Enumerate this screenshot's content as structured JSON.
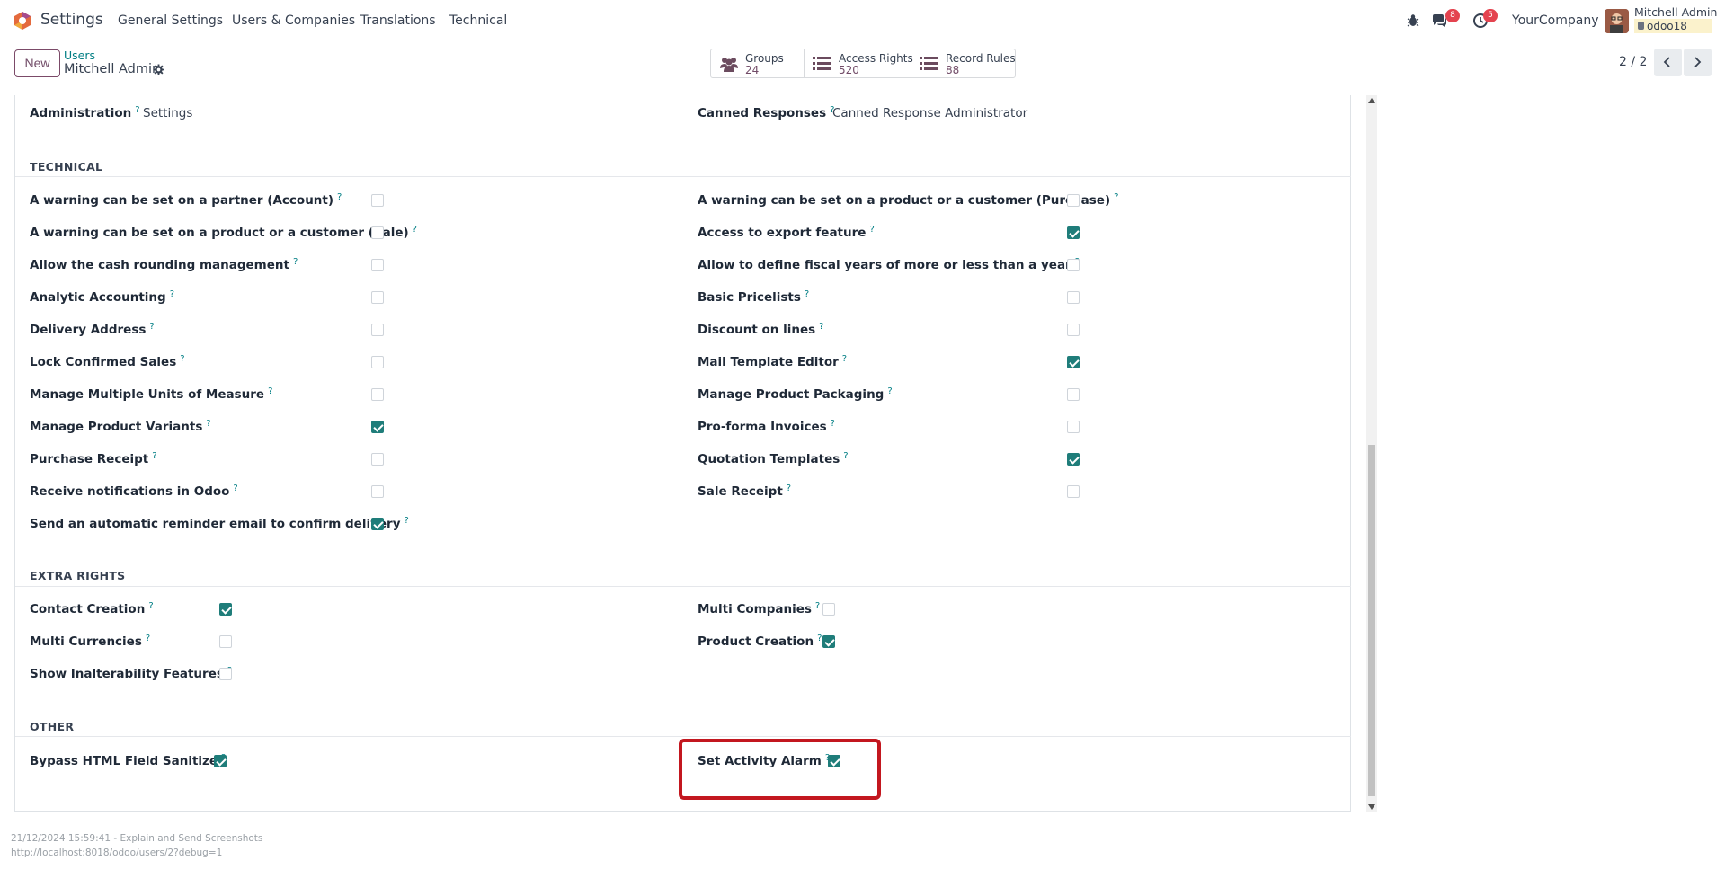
{
  "navbar": {
    "app_name": "Settings",
    "menu": [
      "General Settings",
      "Users & Companies",
      "Translations",
      "Technical"
    ],
    "messages_badge": "8",
    "activities_badge": "5",
    "company": "YourCompany",
    "user_name": "Mitchell Admin",
    "database": "odoo18"
  },
  "control": {
    "new_label": "New",
    "breadcrumb_parent": "Users",
    "breadcrumb_current": "Mitchell Admin",
    "smart_buttons": [
      {
        "label": "Groups",
        "value": "24",
        "icon": "users-icon"
      },
      {
        "label": "Access Rights",
        "value": "520",
        "icon": "list-icon"
      },
      {
        "label": "Record Rules",
        "value": "88",
        "icon": "list-icon"
      }
    ],
    "pager": "2 / 2"
  },
  "top_fields": {
    "administration_label": "Administration",
    "administration_value": "Settings",
    "canned_label": "Canned Responses",
    "canned_value": "Canned Response Administrator"
  },
  "technical": {
    "title": "TECHNICAL",
    "left": [
      {
        "label": "A warning can be set on a partner (Account)",
        "checked": false
      },
      {
        "label": "A warning can be set on a product or a customer (Sale)",
        "checked": false
      },
      {
        "label": "Allow the cash rounding management",
        "checked": false
      },
      {
        "label": "Analytic Accounting",
        "checked": false
      },
      {
        "label": "Delivery Address",
        "checked": false
      },
      {
        "label": "Lock Confirmed Sales",
        "checked": false
      },
      {
        "label": "Manage Multiple Units of Measure",
        "checked": false
      },
      {
        "label": "Manage Product Variants",
        "checked": true
      },
      {
        "label": "Purchase Receipt",
        "checked": false
      },
      {
        "label": "Receive notifications in Odoo",
        "checked": false
      },
      {
        "label": "Send an automatic reminder email to confirm delivery",
        "checked": true
      }
    ],
    "right": [
      {
        "label": "A warning can be set on a product or a customer (Purchase)",
        "checked": false
      },
      {
        "label": "Access to export feature",
        "checked": true
      },
      {
        "label": "Allow to define fiscal years of more or less than a year",
        "checked": false
      },
      {
        "label": "Basic Pricelists",
        "checked": false
      },
      {
        "label": "Discount on lines",
        "checked": false
      },
      {
        "label": "Mail Template Editor",
        "checked": true
      },
      {
        "label": "Manage Product Packaging",
        "checked": false
      },
      {
        "label": "Pro-forma Invoices",
        "checked": false
      },
      {
        "label": "Quotation Templates",
        "checked": true
      },
      {
        "label": "Sale Receipt",
        "checked": false
      }
    ]
  },
  "extra_rights": {
    "title": "EXTRA RIGHTS",
    "left": [
      {
        "label": "Contact Creation",
        "checked": true
      },
      {
        "label": "Multi Currencies",
        "checked": false
      },
      {
        "label": "Show Inalterability Features",
        "checked": false
      }
    ],
    "right": [
      {
        "label": "Multi Companies",
        "checked": false
      },
      {
        "label": "Product Creation",
        "checked": true
      }
    ]
  },
  "other": {
    "title": "OTHER",
    "left": [
      {
        "label": "Bypass HTML Field Sanitize",
        "checked": true
      }
    ],
    "right": [
      {
        "label": "Set Activity Alarm",
        "checked": true
      }
    ]
  },
  "help_mark": "?",
  "footer": {
    "line1": "21/12/2024 15:59:41 - Explain and Send Screenshots",
    "line2": "http://localhost:8018/odoo/users/2?debug=1"
  },
  "colors": {
    "brand": "#714b67",
    "checkbox_on": "#1f7d7a",
    "link": "#017e84",
    "highlight": "#c3171f"
  }
}
